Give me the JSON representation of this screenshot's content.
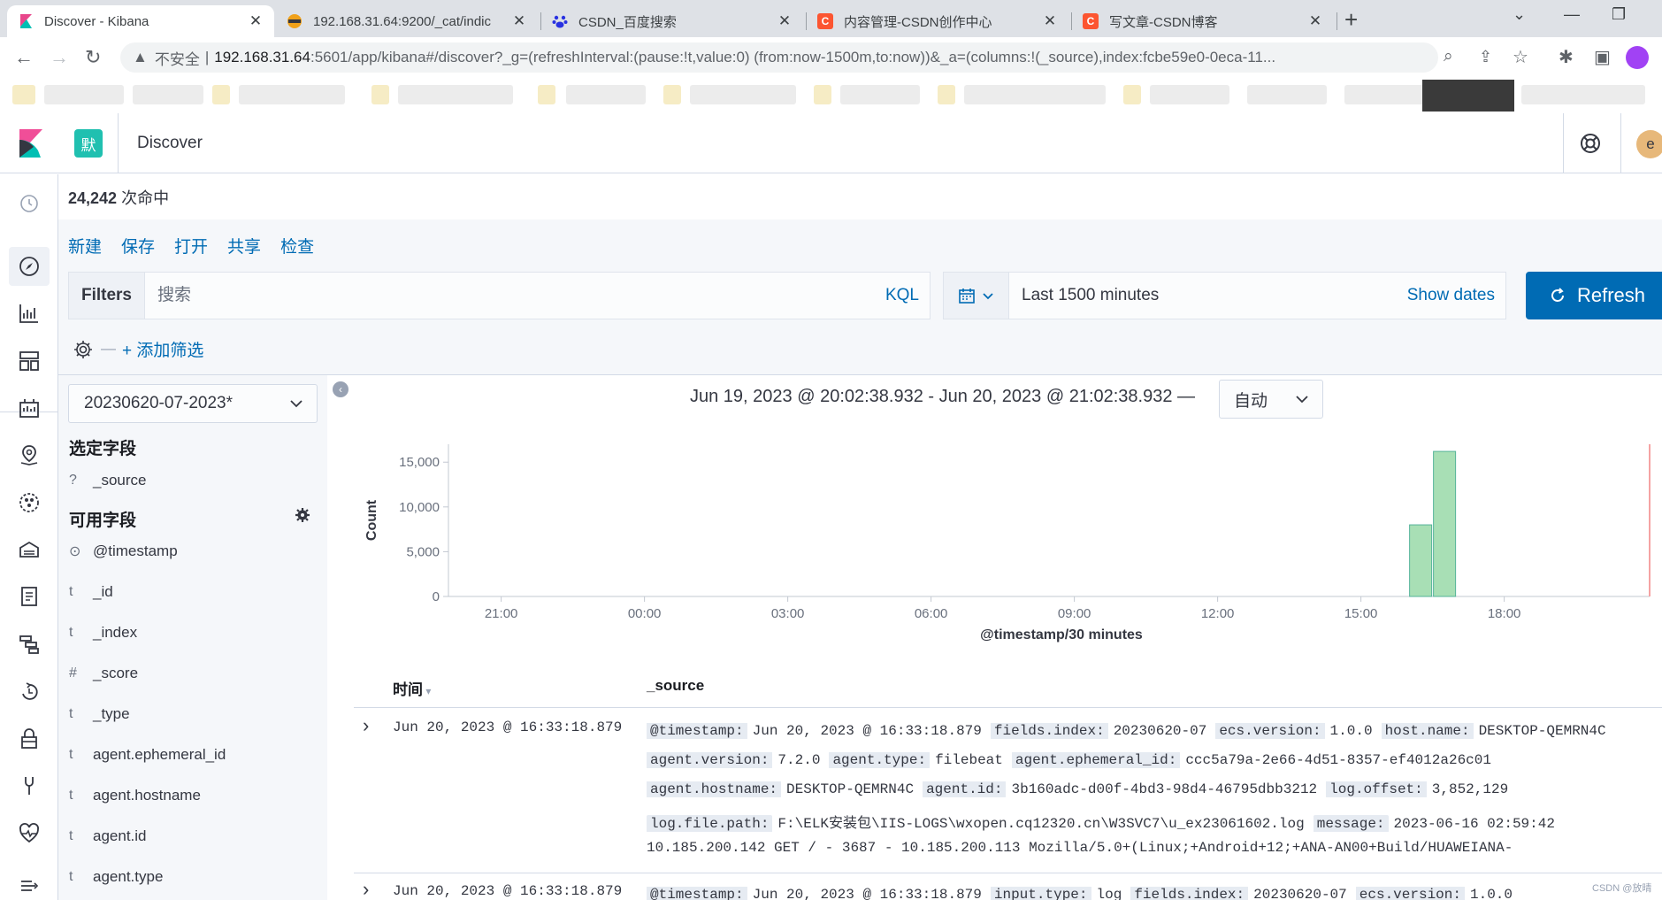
{
  "browser": {
    "tabs": [
      {
        "title": "Discover - Kibana",
        "fav_color": "#e8478b",
        "fav_glyph": ""
      },
      {
        "title": "192.168.31.64:9200/_cat/indic",
        "fav_color": "#f0a11a",
        "fav_glyph": ""
      },
      {
        "title": "CSDN_百度搜索",
        "fav_color": "#2932e1",
        "fav_glyph": ""
      },
      {
        "title": "内容管理-CSDN创作中心",
        "fav_color": "#fc5531",
        "fav_glyph": "C"
      },
      {
        "title": "写文章-CSDN博客",
        "fav_color": "#fc5531",
        "fav_glyph": "C"
      }
    ],
    "address": {
      "insecure_label": "不安全",
      "host": "192.168.31.64",
      "rest": ":5601/app/kibana#/discover?_g=(refreshInterval:(pause:!t,value:0)      (from:now-1500m,to:now))&_a=(columns:!(_source),index:fcbe59e0-0eca-11..."
    }
  },
  "header": {
    "space_initial": "默",
    "page_title": "Discover",
    "user_initial": "e"
  },
  "hits": {
    "count": "24,242",
    "label": "次命中"
  },
  "top_menu": [
    "新建",
    "保存",
    "打开",
    "共享",
    "检查"
  ],
  "query": {
    "filters_label": "Filters",
    "placeholder": "搜索",
    "language": "KQL"
  },
  "datepicker": {
    "range": "Last 1500 minutes",
    "show_dates": "Show dates"
  },
  "refresh_label": "Refresh",
  "add_filter": "+ 添加筛选",
  "sidebar": {
    "index_pattern": "20230620-07-2023*",
    "selected_title": "选定字段",
    "selected_fields": [
      {
        "type": "?",
        "name": "_source"
      }
    ],
    "available_title": "可用字段",
    "available_fields": [
      {
        "type": "⊙",
        "name": "@timestamp"
      },
      {
        "type": "t",
        "name": "_id"
      },
      {
        "type": "t",
        "name": "_index"
      },
      {
        "type": "#",
        "name": "_score"
      },
      {
        "type": "t",
        "name": "_type"
      },
      {
        "type": "t",
        "name": "agent.ephemeral_id"
      },
      {
        "type": "t",
        "name": "agent.hostname"
      },
      {
        "type": "t",
        "name": "agent.id"
      },
      {
        "type": "t",
        "name": "agent.type"
      }
    ]
  },
  "histogram": {
    "range_text": "Jun 19, 2023 @ 20:02:38.932 - Jun 20, 2023 @ 21:02:38.932 —",
    "interval": "自动"
  },
  "chart_data": {
    "type": "bar",
    "x_ticks": [
      "21:00",
      "00:00",
      "03:00",
      "06:00",
      "09:00",
      "12:00",
      "15:00",
      "18:00"
    ],
    "y_ticks": [
      "0",
      "5,000",
      "10,000",
      "15,000"
    ],
    "ylim": [
      0,
      17000
    ],
    "xlabel": "@timestamp/30 minutes",
    "ylabel": "Count",
    "bars": [
      {
        "x": "16:00",
        "value": 8000
      },
      {
        "x": "16:30",
        "value": 16200
      }
    ],
    "bar_color": "#a8dfb5",
    "bar_stroke": "#54b399"
  },
  "table": {
    "col_time": "时间",
    "col_source": "_source",
    "rows": [
      {
        "time": "Jun 20, 2023 @ 16:33:18.879",
        "lines": [
          [
            [
              "@timestamp:",
              "Jun 20, 2023 @ 16:33:18.879"
            ],
            [
              "fields.index:",
              "20230620-07"
            ],
            [
              "ecs.version:",
              "1.0.0"
            ],
            [
              "host.name:",
              "DESKTOP-QEMRN4C"
            ]
          ],
          [
            [
              "agent.version:",
              "7.2.0"
            ],
            [
              "agent.type:",
              "filebeat"
            ],
            [
              "agent.ephemeral_id:",
              "ccc5a79a-2e66-4d51-8357-ef4012a26c01"
            ]
          ],
          [
            [
              "agent.hostname:",
              "DESKTOP-QEMRN4C"
            ],
            [
              "agent.id:",
              "3b160adc-d00f-4bd3-98d4-46795dbb3212"
            ],
            [
              "log.offset:",
              "3,852,129"
            ]
          ],
          [
            [
              "log.file.path:",
              "F:\\ELK安装包\\IIS-LOGS\\wxopen.cq12320.cn\\W3SVC7\\u_ex23061602.log"
            ],
            [
              "message:",
              "2023-06-16 02:59:42"
            ]
          ],
          [
            [
              "",
              "10.185.200.142 GET / - 3687 - 10.185.200.113 Mozilla/5.0+(Linux;+Android+12;+ANA-AN00+Build/HUAWEIANA-"
            ]
          ]
        ]
      },
      {
        "time": "Jun 20, 2023 @ 16:33:18.879",
        "lines": [
          [
            [
              "@timestamp:",
              "Jun 20, 2023 @ 16:33:18.879"
            ],
            [
              "input.type:",
              "log"
            ],
            [
              "fields.index:",
              "20230620-07"
            ],
            [
              "ecs.version:",
              "1.0.0"
            ]
          ]
        ]
      }
    ]
  },
  "watermark": "CSDN @放晴"
}
